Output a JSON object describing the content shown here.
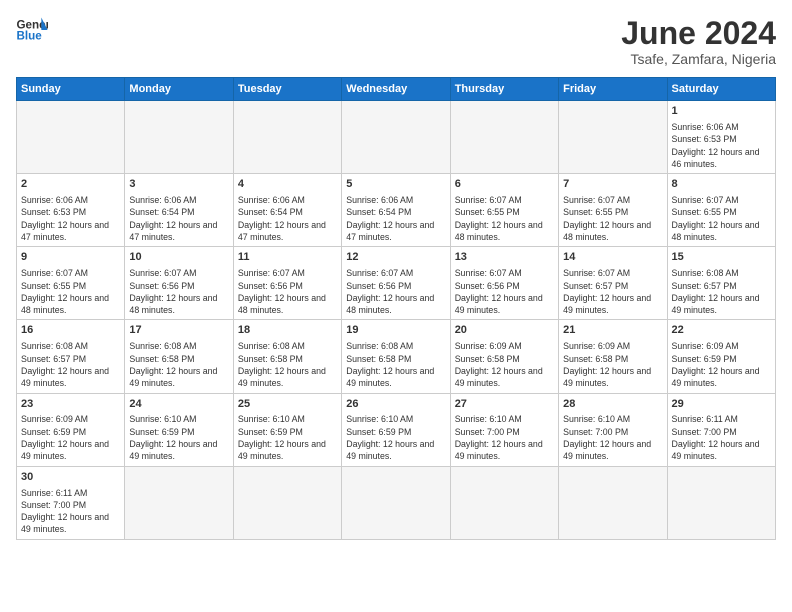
{
  "header": {
    "logo_general": "General",
    "logo_blue": "Blue",
    "month_title": "June 2024",
    "location": "Tsafe, Zamfara, Nigeria"
  },
  "weekdays": [
    "Sunday",
    "Monday",
    "Tuesday",
    "Wednesday",
    "Thursday",
    "Friday",
    "Saturday"
  ],
  "weeks": [
    [
      {
        "day": "",
        "info": "",
        "empty": true
      },
      {
        "day": "",
        "info": "",
        "empty": true
      },
      {
        "day": "",
        "info": "",
        "empty": true
      },
      {
        "day": "",
        "info": "",
        "empty": true
      },
      {
        "day": "",
        "info": "",
        "empty": true
      },
      {
        "day": "",
        "info": "",
        "empty": true
      },
      {
        "day": "1",
        "info": "Sunrise: 6:06 AM\nSunset: 6:53 PM\nDaylight: 12 hours and 46 minutes.",
        "empty": false
      }
    ],
    [
      {
        "day": "2",
        "info": "Sunrise: 6:06 AM\nSunset: 6:53 PM\nDaylight: 12 hours and 47 minutes.",
        "empty": false
      },
      {
        "day": "3",
        "info": "Sunrise: 6:06 AM\nSunset: 6:54 PM\nDaylight: 12 hours and 47 minutes.",
        "empty": false
      },
      {
        "day": "4",
        "info": "Sunrise: 6:06 AM\nSunset: 6:54 PM\nDaylight: 12 hours and 47 minutes.",
        "empty": false
      },
      {
        "day": "5",
        "info": "Sunrise: 6:06 AM\nSunset: 6:54 PM\nDaylight: 12 hours and 47 minutes.",
        "empty": false
      },
      {
        "day": "6",
        "info": "Sunrise: 6:07 AM\nSunset: 6:55 PM\nDaylight: 12 hours and 48 minutes.",
        "empty": false
      },
      {
        "day": "7",
        "info": "Sunrise: 6:07 AM\nSunset: 6:55 PM\nDaylight: 12 hours and 48 minutes.",
        "empty": false
      },
      {
        "day": "8",
        "info": "Sunrise: 6:07 AM\nSunset: 6:55 PM\nDaylight: 12 hours and 48 minutes.",
        "empty": false
      }
    ],
    [
      {
        "day": "9",
        "info": "Sunrise: 6:07 AM\nSunset: 6:55 PM\nDaylight: 12 hours and 48 minutes.",
        "empty": false
      },
      {
        "day": "10",
        "info": "Sunrise: 6:07 AM\nSunset: 6:56 PM\nDaylight: 12 hours and 48 minutes.",
        "empty": false
      },
      {
        "day": "11",
        "info": "Sunrise: 6:07 AM\nSunset: 6:56 PM\nDaylight: 12 hours and 48 minutes.",
        "empty": false
      },
      {
        "day": "12",
        "info": "Sunrise: 6:07 AM\nSunset: 6:56 PM\nDaylight: 12 hours and 48 minutes.",
        "empty": false
      },
      {
        "day": "13",
        "info": "Sunrise: 6:07 AM\nSunset: 6:56 PM\nDaylight: 12 hours and 49 minutes.",
        "empty": false
      },
      {
        "day": "14",
        "info": "Sunrise: 6:07 AM\nSunset: 6:57 PM\nDaylight: 12 hours and 49 minutes.",
        "empty": false
      },
      {
        "day": "15",
        "info": "Sunrise: 6:08 AM\nSunset: 6:57 PM\nDaylight: 12 hours and 49 minutes.",
        "empty": false
      }
    ],
    [
      {
        "day": "16",
        "info": "Sunrise: 6:08 AM\nSunset: 6:57 PM\nDaylight: 12 hours and 49 minutes.",
        "empty": false
      },
      {
        "day": "17",
        "info": "Sunrise: 6:08 AM\nSunset: 6:58 PM\nDaylight: 12 hours and 49 minutes.",
        "empty": false
      },
      {
        "day": "18",
        "info": "Sunrise: 6:08 AM\nSunset: 6:58 PM\nDaylight: 12 hours and 49 minutes.",
        "empty": false
      },
      {
        "day": "19",
        "info": "Sunrise: 6:08 AM\nSunset: 6:58 PM\nDaylight: 12 hours and 49 minutes.",
        "empty": false
      },
      {
        "day": "20",
        "info": "Sunrise: 6:09 AM\nSunset: 6:58 PM\nDaylight: 12 hours and 49 minutes.",
        "empty": false
      },
      {
        "day": "21",
        "info": "Sunrise: 6:09 AM\nSunset: 6:58 PM\nDaylight: 12 hours and 49 minutes.",
        "empty": false
      },
      {
        "day": "22",
        "info": "Sunrise: 6:09 AM\nSunset: 6:59 PM\nDaylight: 12 hours and 49 minutes.",
        "empty": false
      }
    ],
    [
      {
        "day": "23",
        "info": "Sunrise: 6:09 AM\nSunset: 6:59 PM\nDaylight: 12 hours and 49 minutes.",
        "empty": false
      },
      {
        "day": "24",
        "info": "Sunrise: 6:10 AM\nSunset: 6:59 PM\nDaylight: 12 hours and 49 minutes.",
        "empty": false
      },
      {
        "day": "25",
        "info": "Sunrise: 6:10 AM\nSunset: 6:59 PM\nDaylight: 12 hours and 49 minutes.",
        "empty": false
      },
      {
        "day": "26",
        "info": "Sunrise: 6:10 AM\nSunset: 6:59 PM\nDaylight: 12 hours and 49 minutes.",
        "empty": false
      },
      {
        "day": "27",
        "info": "Sunrise: 6:10 AM\nSunset: 7:00 PM\nDaylight: 12 hours and 49 minutes.",
        "empty": false
      },
      {
        "day": "28",
        "info": "Sunrise: 6:10 AM\nSunset: 7:00 PM\nDaylight: 12 hours and 49 minutes.",
        "empty": false
      },
      {
        "day": "29",
        "info": "Sunrise: 6:11 AM\nSunset: 7:00 PM\nDaylight: 12 hours and 49 minutes.",
        "empty": false
      }
    ],
    [
      {
        "day": "30",
        "info": "Sunrise: 6:11 AM\nSunset: 7:00 PM\nDaylight: 12 hours and 49 minutes.",
        "empty": false
      },
      {
        "day": "",
        "info": "",
        "empty": true
      },
      {
        "day": "",
        "info": "",
        "empty": true
      },
      {
        "day": "",
        "info": "",
        "empty": true
      },
      {
        "day": "",
        "info": "",
        "empty": true
      },
      {
        "day": "",
        "info": "",
        "empty": true
      },
      {
        "day": "",
        "info": "",
        "empty": true
      }
    ]
  ]
}
